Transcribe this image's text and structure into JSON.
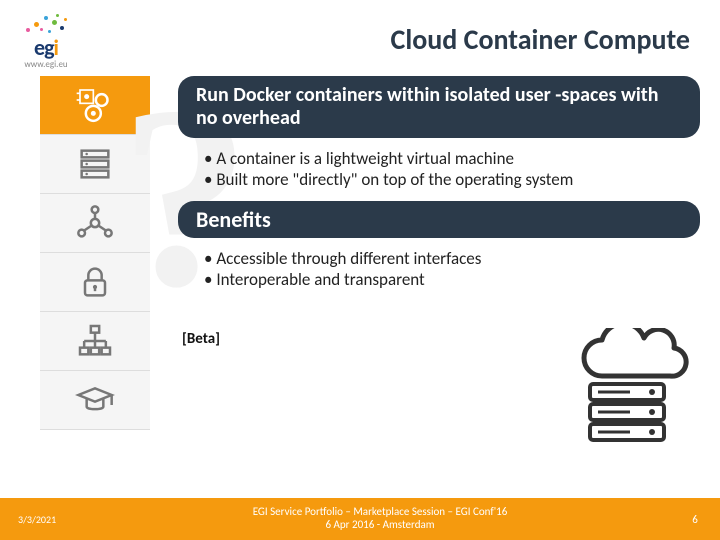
{
  "header": {
    "logo_text_e": "e",
    "logo_text_g": "g",
    "logo_text_i": "i",
    "logo_url": "www.egi.eu",
    "title": "Cloud Container Compute"
  },
  "main": {
    "headline": "Run Docker containers within isolated user -spaces with no overhead",
    "bullets1": [
      "A container is a lightweight virtual machine",
      "Built more \"directly\" on top of the operating system"
    ],
    "benefits_label": "Benefits",
    "bullets2": [
      "Accessible through different interfaces",
      "Interoperable and transparent"
    ],
    "beta_label": "[Beta]"
  },
  "sidebar": {
    "items": [
      {
        "name": "compute",
        "active": true
      },
      {
        "name": "storage",
        "active": false
      },
      {
        "name": "network",
        "active": false
      },
      {
        "name": "security",
        "active": false
      },
      {
        "name": "orchestration",
        "active": false
      },
      {
        "name": "training",
        "active": false
      }
    ]
  },
  "footer": {
    "date": "3/3/2021",
    "center_line1": "EGI Service Portfolio – Marketplace Session – EGI Conf'16",
    "center_line2": "6 Apr 2016 - Amsterdam",
    "page": "6"
  },
  "colors": {
    "accent": "#f59a0e",
    "dark": "#2b3a4a"
  }
}
